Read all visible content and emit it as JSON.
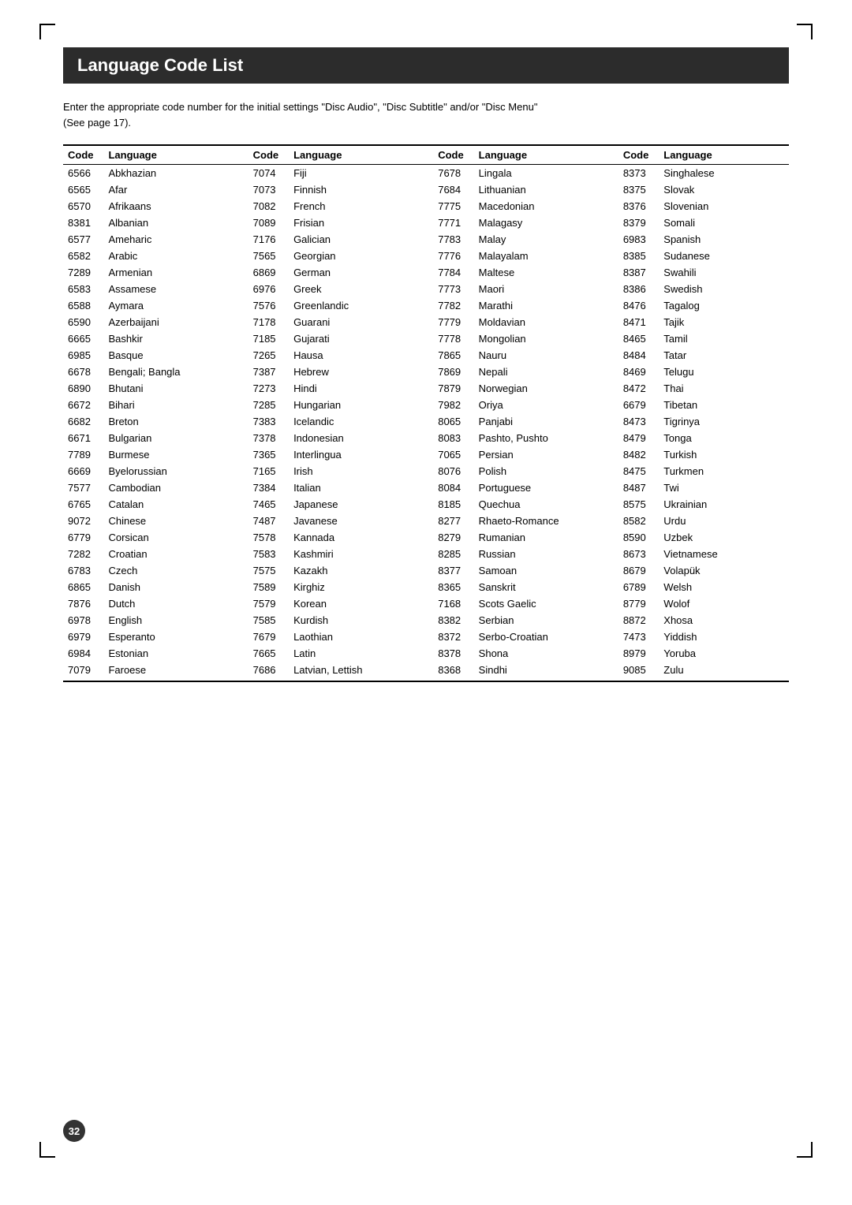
{
  "page": {
    "title": "Language Code List",
    "description_line1": "Enter the appropriate code number for the initial settings \"Disc Audio\", \"Disc Subtitle\" and/or \"Disc Menu\"",
    "description_line2": "(See page 17).",
    "page_number": "32"
  },
  "table": {
    "headers": [
      {
        "code": "Code",
        "language": "Language"
      },
      {
        "code": "Code",
        "language": "Language"
      },
      {
        "code": "Code",
        "language": "Language"
      },
      {
        "code": "Code",
        "language": "Language"
      }
    ],
    "rows": [
      [
        {
          "code": "6566",
          "lang": "Abkhazian"
        },
        {
          "code": "7074",
          "lang": "Fiji"
        },
        {
          "code": "7678",
          "lang": "Lingala"
        },
        {
          "code": "8373",
          "lang": "Singhalese"
        }
      ],
      [
        {
          "code": "6565",
          "lang": "Afar"
        },
        {
          "code": "7073",
          "lang": "Finnish"
        },
        {
          "code": "7684",
          "lang": "Lithuanian"
        },
        {
          "code": "8375",
          "lang": "Slovak"
        }
      ],
      [
        {
          "code": "6570",
          "lang": "Afrikaans"
        },
        {
          "code": "7082",
          "lang": "French"
        },
        {
          "code": "7775",
          "lang": "Macedonian"
        },
        {
          "code": "8376",
          "lang": "Slovenian"
        }
      ],
      [
        {
          "code": "8381",
          "lang": "Albanian"
        },
        {
          "code": "7089",
          "lang": "Frisian"
        },
        {
          "code": "7771",
          "lang": "Malagasy"
        },
        {
          "code": "8379",
          "lang": "Somali"
        }
      ],
      [
        {
          "code": "6577",
          "lang": "Ameharic"
        },
        {
          "code": "7176",
          "lang": "Galician"
        },
        {
          "code": "7783",
          "lang": "Malay"
        },
        {
          "code": "6983",
          "lang": "Spanish"
        }
      ],
      [
        {
          "code": "6582",
          "lang": "Arabic"
        },
        {
          "code": "7565",
          "lang": "Georgian"
        },
        {
          "code": "7776",
          "lang": "Malayalam"
        },
        {
          "code": "8385",
          "lang": "Sudanese"
        }
      ],
      [
        {
          "code": "7289",
          "lang": "Armenian"
        },
        {
          "code": "6869",
          "lang": "German"
        },
        {
          "code": "7784",
          "lang": "Maltese"
        },
        {
          "code": "8387",
          "lang": "Swahili"
        }
      ],
      [
        {
          "code": "6583",
          "lang": "Assamese"
        },
        {
          "code": "6976",
          "lang": "Greek"
        },
        {
          "code": "7773",
          "lang": "Maori"
        },
        {
          "code": "8386",
          "lang": "Swedish"
        }
      ],
      [
        {
          "code": "6588",
          "lang": "Aymara"
        },
        {
          "code": "7576",
          "lang": "Greenlandic"
        },
        {
          "code": "7782",
          "lang": "Marathi"
        },
        {
          "code": "8476",
          "lang": "Tagalog"
        }
      ],
      [
        {
          "code": "6590",
          "lang": "Azerbaijani"
        },
        {
          "code": "7178",
          "lang": "Guarani"
        },
        {
          "code": "7779",
          "lang": "Moldavian"
        },
        {
          "code": "8471",
          "lang": "Tajik"
        }
      ],
      [
        {
          "code": "6665",
          "lang": "Bashkir"
        },
        {
          "code": "7185",
          "lang": "Gujarati"
        },
        {
          "code": "7778",
          "lang": "Mongolian"
        },
        {
          "code": "8465",
          "lang": "Tamil"
        }
      ],
      [
        {
          "code": "6985",
          "lang": "Basque"
        },
        {
          "code": "7265",
          "lang": "Hausa"
        },
        {
          "code": "7865",
          "lang": "Nauru"
        },
        {
          "code": "8484",
          "lang": "Tatar"
        }
      ],
      [
        {
          "code": "6678",
          "lang": "Bengali; Bangla"
        },
        {
          "code": "7387",
          "lang": "Hebrew"
        },
        {
          "code": "7869",
          "lang": "Nepali"
        },
        {
          "code": "8469",
          "lang": "Telugu"
        }
      ],
      [
        {
          "code": "6890",
          "lang": "Bhutani"
        },
        {
          "code": "7273",
          "lang": "Hindi"
        },
        {
          "code": "7879",
          "lang": "Norwegian"
        },
        {
          "code": "8472",
          "lang": "Thai"
        }
      ],
      [
        {
          "code": "6672",
          "lang": "Bihari"
        },
        {
          "code": "7285",
          "lang": "Hungarian"
        },
        {
          "code": "7982",
          "lang": "Oriya"
        },
        {
          "code": "6679",
          "lang": "Tibetan"
        }
      ],
      [
        {
          "code": "6682",
          "lang": "Breton"
        },
        {
          "code": "7383",
          "lang": "Icelandic"
        },
        {
          "code": "8065",
          "lang": "Panjabi"
        },
        {
          "code": "8473",
          "lang": "Tigrinya"
        }
      ],
      [
        {
          "code": "6671",
          "lang": "Bulgarian"
        },
        {
          "code": "7378",
          "lang": "Indonesian"
        },
        {
          "code": "8083",
          "lang": "Pashto, Pushto"
        },
        {
          "code": "8479",
          "lang": "Tonga"
        }
      ],
      [
        {
          "code": "7789",
          "lang": "Burmese"
        },
        {
          "code": "7365",
          "lang": "Interlingua"
        },
        {
          "code": "7065",
          "lang": "Persian"
        },
        {
          "code": "8482",
          "lang": "Turkish"
        }
      ],
      [
        {
          "code": "6669",
          "lang": "Byelorussian"
        },
        {
          "code": "7165",
          "lang": "Irish"
        },
        {
          "code": "8076",
          "lang": "Polish"
        },
        {
          "code": "8475",
          "lang": "Turkmen"
        }
      ],
      [
        {
          "code": "7577",
          "lang": "Cambodian"
        },
        {
          "code": "7384",
          "lang": "Italian"
        },
        {
          "code": "8084",
          "lang": "Portuguese"
        },
        {
          "code": "8487",
          "lang": "Twi"
        }
      ],
      [
        {
          "code": "6765",
          "lang": "Catalan"
        },
        {
          "code": "7465",
          "lang": "Japanese"
        },
        {
          "code": "8185",
          "lang": "Quechua"
        },
        {
          "code": "8575",
          "lang": "Ukrainian"
        }
      ],
      [
        {
          "code": "9072",
          "lang": "Chinese"
        },
        {
          "code": "7487",
          "lang": "Javanese"
        },
        {
          "code": "8277",
          "lang": "Rhaeto-Romance"
        },
        {
          "code": "8582",
          "lang": "Urdu"
        }
      ],
      [
        {
          "code": "6779",
          "lang": "Corsican"
        },
        {
          "code": "7578",
          "lang": "Kannada"
        },
        {
          "code": "8279",
          "lang": "Rumanian"
        },
        {
          "code": "8590",
          "lang": "Uzbek"
        }
      ],
      [
        {
          "code": "7282",
          "lang": "Croatian"
        },
        {
          "code": "7583",
          "lang": "Kashmiri"
        },
        {
          "code": "8285",
          "lang": "Russian"
        },
        {
          "code": "8673",
          "lang": "Vietnamese"
        }
      ],
      [
        {
          "code": "6783",
          "lang": "Czech"
        },
        {
          "code": "7575",
          "lang": "Kazakh"
        },
        {
          "code": "8377",
          "lang": "Samoan"
        },
        {
          "code": "8679",
          "lang": "Volapük"
        }
      ],
      [
        {
          "code": "6865",
          "lang": "Danish"
        },
        {
          "code": "7589",
          "lang": "Kirghiz"
        },
        {
          "code": "8365",
          "lang": "Sanskrit"
        },
        {
          "code": "6789",
          "lang": "Welsh"
        }
      ],
      [
        {
          "code": "7876",
          "lang": "Dutch"
        },
        {
          "code": "7579",
          "lang": "Korean"
        },
        {
          "code": "7168",
          "lang": "Scots Gaelic"
        },
        {
          "code": "8779",
          "lang": "Wolof"
        }
      ],
      [
        {
          "code": "6978",
          "lang": "English"
        },
        {
          "code": "7585",
          "lang": "Kurdish"
        },
        {
          "code": "8382",
          "lang": "Serbian"
        },
        {
          "code": "8872",
          "lang": "Xhosa"
        }
      ],
      [
        {
          "code": "6979",
          "lang": "Esperanto"
        },
        {
          "code": "7679",
          "lang": "Laothian"
        },
        {
          "code": "8372",
          "lang": "Serbo-Croatian"
        },
        {
          "code": "7473",
          "lang": "Yiddish"
        }
      ],
      [
        {
          "code": "6984",
          "lang": "Estonian"
        },
        {
          "code": "7665",
          "lang": "Latin"
        },
        {
          "code": "8378",
          "lang": "Shona"
        },
        {
          "code": "8979",
          "lang": "Yoruba"
        }
      ],
      [
        {
          "code": "7079",
          "lang": "Faroese"
        },
        {
          "code": "7686",
          "lang": "Latvian, Lettish"
        },
        {
          "code": "8368",
          "lang": "Sindhi"
        },
        {
          "code": "9085",
          "lang": "Zulu"
        }
      ]
    ]
  }
}
